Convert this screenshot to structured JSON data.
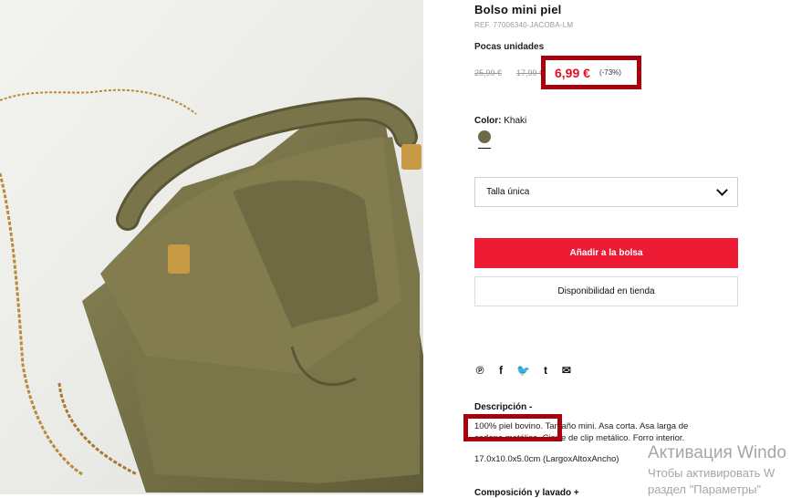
{
  "product": {
    "title": "Bolso mini piel",
    "reference": "REF. 77006340-JACOBA-LM",
    "stock_notice": "Pocas unidades",
    "prices": {
      "original_1": "25,99 €",
      "original_2": "17,99 €",
      "current": "6,99 €",
      "discount": "(-73%)"
    },
    "color": {
      "label": "Color:",
      "value": "Khaki",
      "swatch_hex": "#6d6a4a"
    },
    "size_select": {
      "value": "Talla única"
    },
    "buttons": {
      "add_to_bag": "Añadir a la bolsa",
      "store_availability": "Disponibilidad en tienda"
    },
    "social_icons": [
      {
        "name": "pinterest-icon",
        "glyph": "℗"
      },
      {
        "name": "facebook-icon",
        "glyph": "f"
      },
      {
        "name": "twitter-icon",
        "glyph": "🐦"
      },
      {
        "name": "tumblr-icon",
        "glyph": "t"
      },
      {
        "name": "email-icon",
        "glyph": "✉"
      }
    ],
    "description": {
      "heading": "Descripción -",
      "line1": "100% piel bovino. Tamaño mini. Asa corta. Asa larga de",
      "line2": "cadena metálica. Cierre de clip metálico. Forro interior.",
      "dimensions": "17.0x10.0x5.0cm (LargoxAltoxAncho)"
    },
    "composition_heading": "Composición y lavado +"
  },
  "watermark": {
    "line1": "Активация Windo",
    "line2": "Чтобы активировать W",
    "line3": "раздел \"Параметры\""
  },
  "colors": {
    "accent_red": "#ee1b35",
    "highlight_box": "#a8000d",
    "price_red": "#e0102a"
  }
}
